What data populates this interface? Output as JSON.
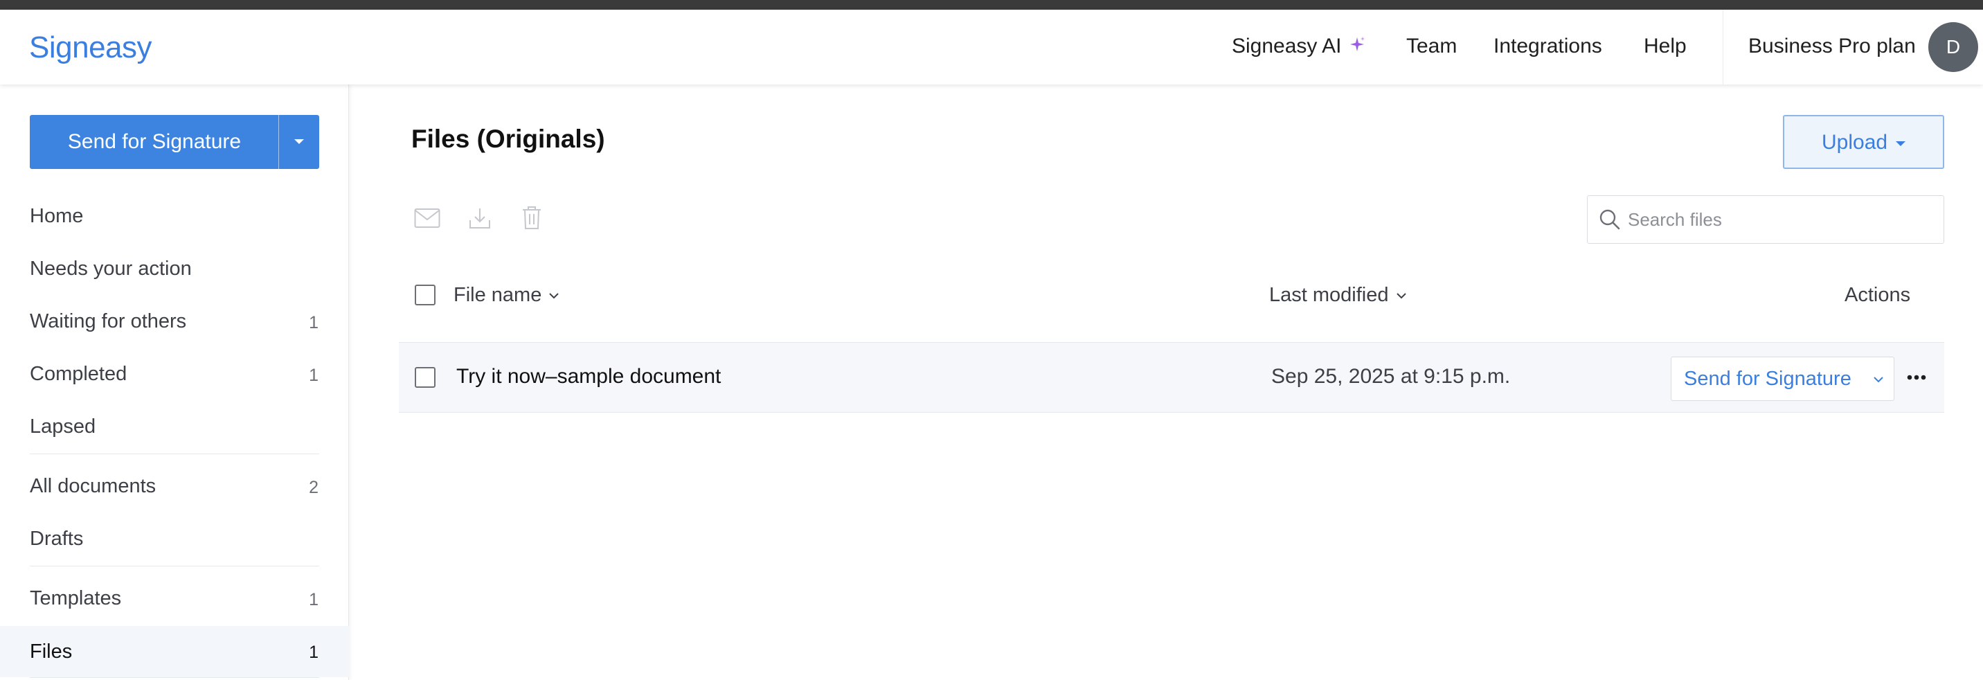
{
  "header": {
    "logo": "Signeasy",
    "nav": [
      {
        "label": "Signeasy AI"
      },
      {
        "label": "Team"
      },
      {
        "label": "Integrations"
      },
      {
        "label": "Help"
      }
    ],
    "plan_label": "Business Pro plan",
    "avatar_initial": "D"
  },
  "sidebar": {
    "send_button_label": "Send for Signature",
    "items": [
      {
        "label": "Home",
        "count": ""
      },
      {
        "label": "Needs your action",
        "count": ""
      },
      {
        "label": "Waiting for others",
        "count": "1"
      },
      {
        "label": "Completed",
        "count": "1"
      },
      {
        "label": "Lapsed",
        "count": ""
      },
      {
        "label": "All documents",
        "count": "2"
      },
      {
        "label": "Drafts",
        "count": ""
      },
      {
        "label": "Templates",
        "count": "1"
      },
      {
        "label": "Files",
        "count": "1"
      }
    ]
  },
  "main": {
    "title": "Files (Originals)",
    "upload_label": "Upload",
    "search_placeholder": "Search files",
    "columns": {
      "name": "File name",
      "modified": "Last modified",
      "actions": "Actions"
    },
    "rows": [
      {
        "name": "Try it now–sample document",
        "modified": "Sep 25, 2025 at 9:15 p.m.",
        "action_label": "Send for Signature"
      }
    ]
  },
  "colors": {
    "brand_blue": "#3a7fdf",
    "button_blue": "#3d84e0",
    "ai_sparkle": "#9b5de5"
  }
}
